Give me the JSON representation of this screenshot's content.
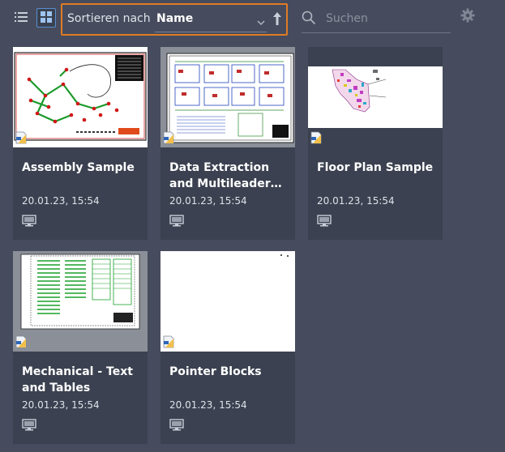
{
  "toolbar": {
    "list_view_icon": "list-icon",
    "grid_view_icon": "grid-icon",
    "sort_label": "Sortieren nach",
    "sort_value": "Name",
    "sort_direction_icon": "arrow-up-icon",
    "search_placeholder": "Suchen",
    "settings_icon": "gear-icon"
  },
  "colors": {
    "background": "#464c5d",
    "card": "#3b4150",
    "highlight_border": "#e07b24",
    "active_view": "#5a8fd0"
  },
  "files": [
    {
      "title": "Assembly Sample",
      "date": "20.01.23, 15:54",
      "location_icon": "computer-icon",
      "type_icon": "dwg-file-icon"
    },
    {
      "title": "Data Extraction and Multileader…",
      "date": "20.01.23, 15:54",
      "location_icon": "computer-icon",
      "type_icon": "dwg-file-icon"
    },
    {
      "title": "Floor Plan Sample",
      "date": "20.01.23, 15:54",
      "location_icon": "computer-icon",
      "type_icon": "dwg-file-icon"
    },
    {
      "title": "Mechanical - Text and Tables",
      "date": "20.01.23, 15:54",
      "location_icon": "computer-icon",
      "type_icon": "dwg-file-icon"
    },
    {
      "title": "Pointer Blocks",
      "date": "20.01.23, 15:54",
      "location_icon": "computer-icon",
      "type_icon": "dwg-file-icon"
    }
  ]
}
